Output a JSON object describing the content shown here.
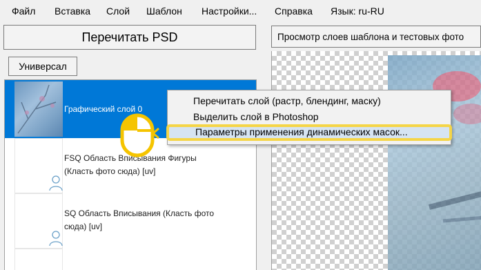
{
  "menu": {
    "items": [
      "Файл",
      "Вставка",
      "Слой",
      "Шаблон",
      "Настройки...",
      "Справка",
      "Язык: ru-RU"
    ]
  },
  "left_pane": {
    "reread_button": "Перечитать PSD",
    "universal_button": "Универсал",
    "layers": [
      {
        "line1": "Графический слой 0",
        "line2": "",
        "selected": true
      },
      {
        "line1": "FSQ Область Вписывания Фигуры",
        "line2": "(Класть фото сюда) [uv]",
        "selected": false
      },
      {
        "line1": "SQ Область Вписывания (Класть фото",
        "line2": "сюда) [uv]",
        "selected": false
      }
    ]
  },
  "right_pane": {
    "preview_button": "Просмотр слоев шаблона и тестовых фото"
  },
  "context_menu": {
    "items": [
      "Перечитать слой (растр, блендинг, маску)",
      "Выделить слой в Photoshop",
      "Параметры применения динамических масок..."
    ],
    "highlighted_index": 2
  },
  "colors": {
    "selection": "#0078d7",
    "highlight_border": "#f5d547",
    "window_bg": "#f0f0f0"
  },
  "icons": {
    "layer_placeholder": "person-icon",
    "cursor": "mouse-icon"
  }
}
